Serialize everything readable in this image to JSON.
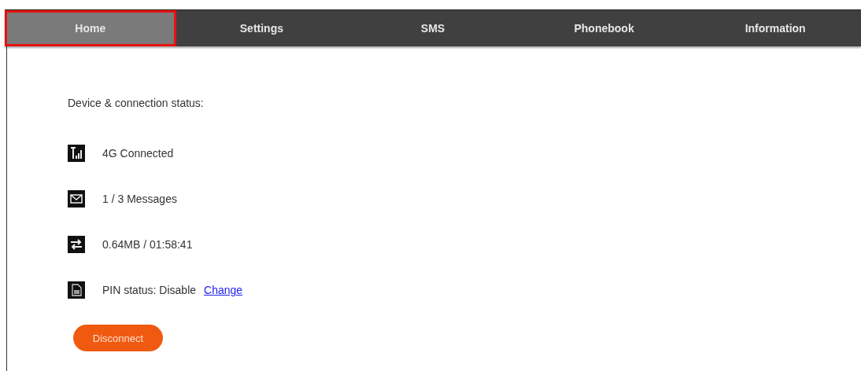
{
  "tabs": [
    {
      "label": "Home",
      "selected": true
    },
    {
      "label": "Settings",
      "selected": false
    },
    {
      "label": "SMS",
      "selected": false
    },
    {
      "label": "Phonebook",
      "selected": false
    },
    {
      "label": "Information",
      "selected": false
    }
  ],
  "heading": "Device & connection status:",
  "status_items": [
    {
      "kind": "signal",
      "text": "4G Connected"
    },
    {
      "kind": "mail",
      "text": "1 / 3 Messages"
    },
    {
      "kind": "transfer",
      "text": "0.64MB / 01:58:41"
    },
    {
      "kind": "sim",
      "text": "PIN status: Disable",
      "link": "Change"
    }
  ],
  "button": "Disconnect"
}
